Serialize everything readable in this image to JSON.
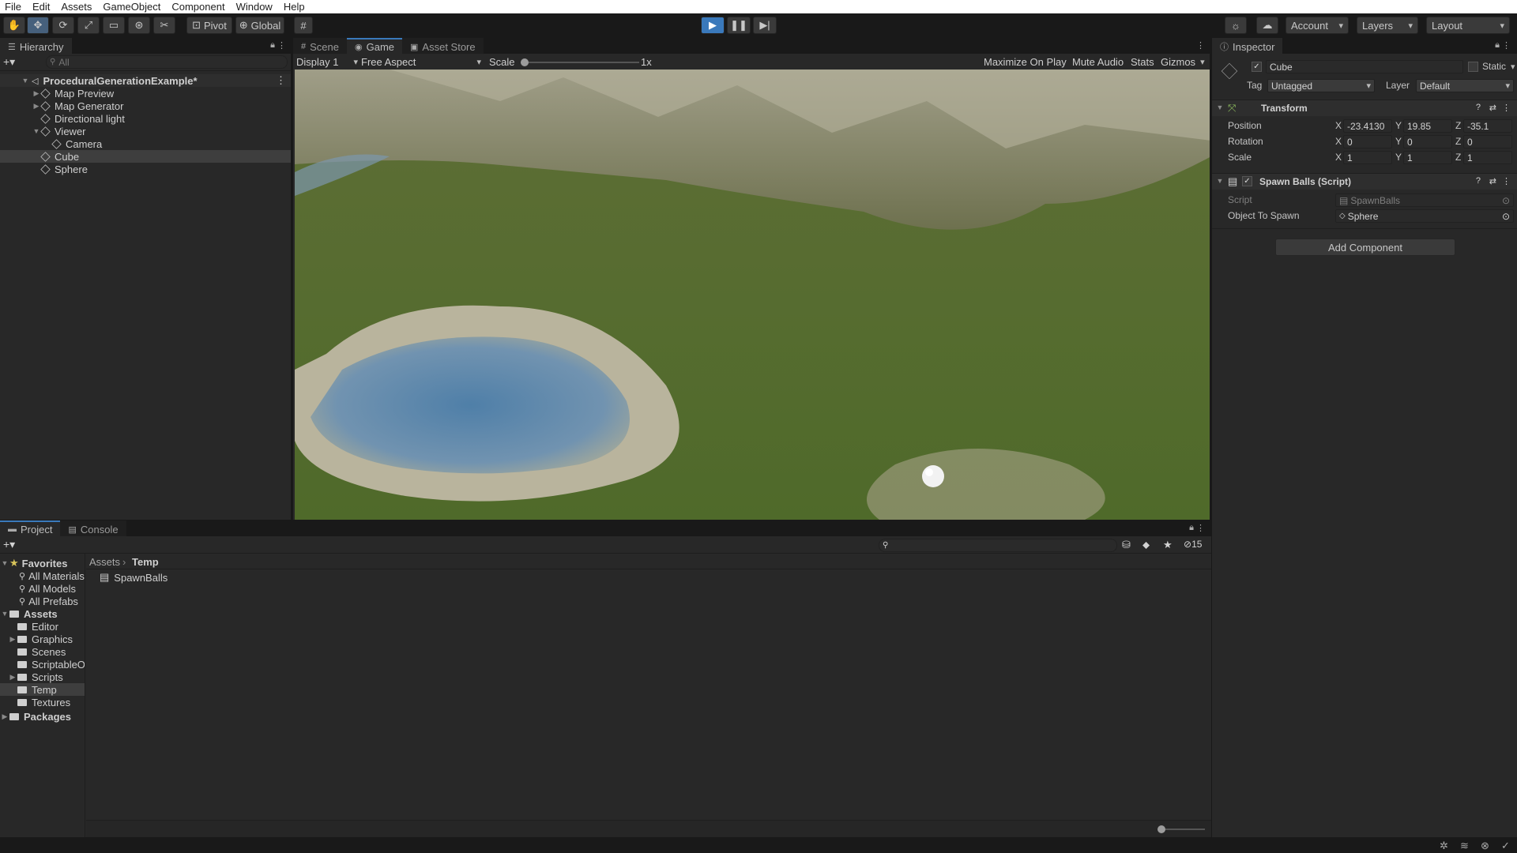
{
  "menu": [
    "File",
    "Edit",
    "Assets",
    "GameObject",
    "Component",
    "Window",
    "Help"
  ],
  "toolbar": {
    "pivot": "Pivot",
    "global": "Global",
    "account": "Account",
    "layers": "Layers",
    "layout": "Layout"
  },
  "hierarchy": {
    "title": "Hierarchy",
    "search_placeholder": "All",
    "scene": "ProceduralGenerationExample*",
    "items": [
      {
        "label": "Map Preview",
        "depth": 1,
        "expandable": true
      },
      {
        "label": "Map Generator",
        "depth": 1,
        "expandable": true
      },
      {
        "label": "Directional light",
        "depth": 1,
        "expandable": false
      },
      {
        "label": "Viewer",
        "depth": 1,
        "expandable": true
      },
      {
        "label": "Camera",
        "depth": 2,
        "expandable": false
      },
      {
        "label": "Cube",
        "depth": 1,
        "expandable": false,
        "selected": true
      },
      {
        "label": "Sphere",
        "depth": 1,
        "expandable": false
      }
    ]
  },
  "game_view": {
    "tabs": [
      "Scene",
      "Game",
      "Asset Store"
    ],
    "active_tab": "Game",
    "display": "Display 1",
    "aspect": "Free Aspect",
    "scale_label": "Scale",
    "scale_value": "1x",
    "maximize": "Maximize On Play",
    "mute": "Mute Audio",
    "stats": "Stats",
    "gizmos": "Gizmos"
  },
  "inspector": {
    "title": "Inspector",
    "object_name": "Cube",
    "static_label": "Static",
    "tag_label": "Tag",
    "tag_value": "Untagged",
    "layer_label": "Layer",
    "layer_value": "Default",
    "transform": {
      "title": "Transform",
      "position_label": "Position",
      "rotation_label": "Rotation",
      "scale_label": "Scale",
      "position": {
        "x": "-23.4130",
        "y": "19.85",
        "z": "-35.1"
      },
      "rotation": {
        "x": "0",
        "y": "0",
        "z": "0"
      },
      "scale": {
        "x": "1",
        "y": "1",
        "z": "1"
      },
      "axis_x": "X",
      "axis_y": "Y",
      "axis_z": "Z"
    },
    "script": {
      "title": "Spawn Balls (Script)",
      "script_label": "Script",
      "script_value": "SpawnBalls",
      "spawn_label": "Object To Spawn",
      "spawn_value": "Sphere"
    },
    "add_component": "Add Component"
  },
  "project": {
    "tabs": [
      "Project",
      "Console"
    ],
    "hidden_count": "15",
    "favorites_label": "Favorites",
    "favorites": [
      "All Materials",
      "All Models",
      "All Prefabs"
    ],
    "assets_label": "Assets",
    "folders": [
      {
        "label": "Editor",
        "expandable": false
      },
      {
        "label": "Graphics",
        "expandable": true
      },
      {
        "label": "Scenes",
        "expandable": false
      },
      {
        "label": "ScriptableO",
        "expandable": false
      },
      {
        "label": "Scripts",
        "expandable": true
      },
      {
        "label": "Temp",
        "expandable": false,
        "selected": true
      },
      {
        "label": "Textures",
        "expandable": false
      }
    ],
    "packages_label": "Packages",
    "breadcrumb_root": "Assets",
    "breadcrumb_current": "Temp",
    "files": [
      "SpawnBalls"
    ]
  },
  "colors": {
    "accent": "#3a79bb",
    "selected_row": "#3e3e3e",
    "play_active": "#46607c"
  }
}
